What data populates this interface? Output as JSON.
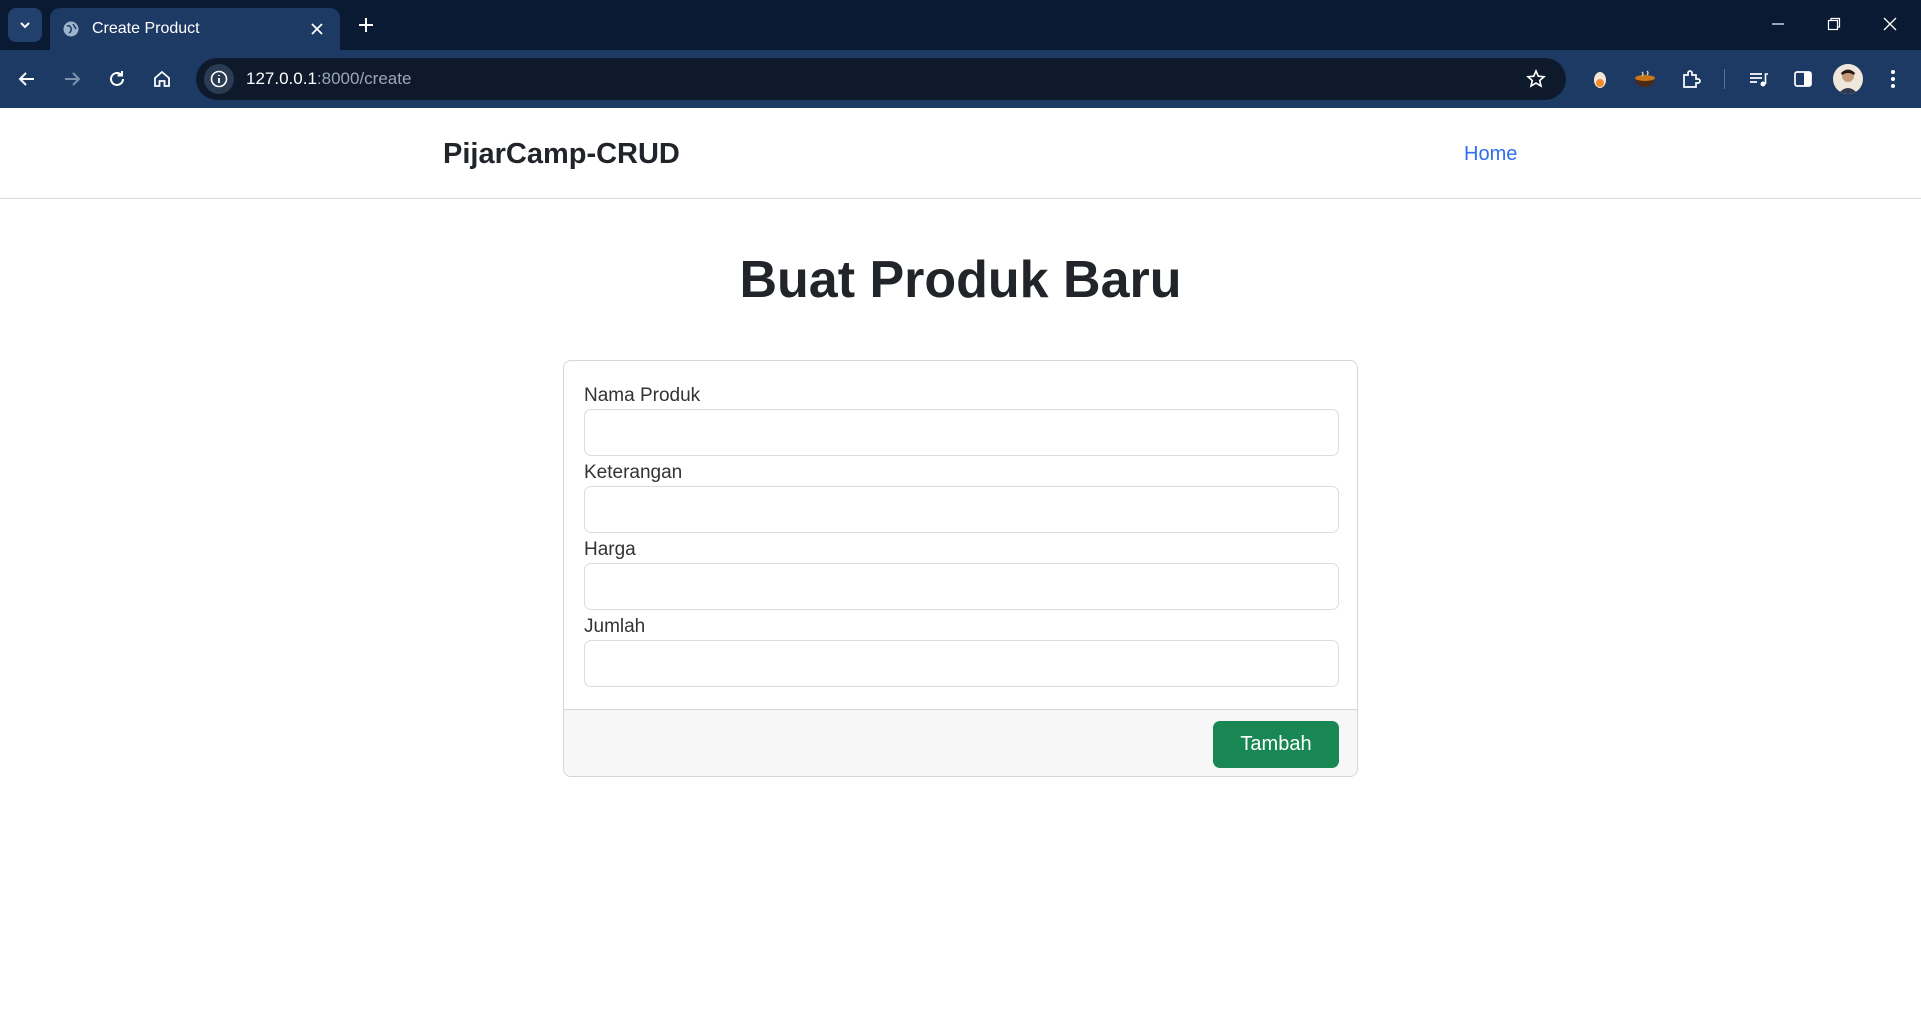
{
  "browser": {
    "tab_title": "Create Product",
    "url_host": "127.0.0.1",
    "url_rest": ":8000/create"
  },
  "navbar": {
    "brand": "PijarCamp-CRUD",
    "home_link": "Home"
  },
  "page": {
    "title": "Buat Produk Baru"
  },
  "form": {
    "fields": [
      {
        "label": "Nama Produk",
        "value": ""
      },
      {
        "label": "Keterangan",
        "value": ""
      },
      {
        "label": "Harga",
        "value": ""
      },
      {
        "label": "Jumlah",
        "value": ""
      }
    ],
    "submit_label": "Tambah"
  },
  "colors": {
    "accent_link": "#2f6fea",
    "submit_button": "#198754",
    "chrome_dark": "#0b1a33",
    "chrome_toolbar": "#1d3a64"
  }
}
